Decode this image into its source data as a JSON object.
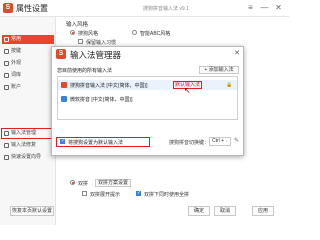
{
  "window": {
    "logo": "S",
    "title": "属性设置",
    "subtitle": "搜狗拼音输入法 v9.1",
    "controls": {
      "menu": "≡",
      "minimize": "—",
      "close": "✕"
    }
  },
  "sidebar": {
    "items": [
      {
        "label": "常用",
        "state": "active"
      },
      {
        "label": "按键",
        "state": ""
      },
      {
        "label": "外观",
        "state": ""
      },
      {
        "label": "词库",
        "state": ""
      },
      {
        "label": "账户",
        "state": ""
      },
      {
        "label": "输入法管理",
        "state": "highlight"
      },
      {
        "label": "输入法修复",
        "state": ""
      },
      {
        "label": "快速设置向导",
        "state": ""
      }
    ],
    "restore_button": "恢复本页默认设置"
  },
  "main": {
    "section_title": "输入风格",
    "style_options": [
      {
        "label": "搜狗风格",
        "checked": true
      },
      {
        "label": "智能ABC风格",
        "checked": false
      }
    ],
    "keep_habit_label": "保留输入习惯",
    "bottom": {
      "double_pinyin_label": "双拼",
      "double_pinyin_button": "双拼方案设置",
      "show_double_hint_label": "双拼展开提示",
      "dual_use_label": "双拼下同时使用全拼",
      "buttons": {
        "ok": "确定",
        "cancel": "取消",
        "apply": "应用"
      }
    }
  },
  "dialog": {
    "logo": "S",
    "title": "输入法管理器",
    "close_label": "✕",
    "subtitle": "您目前使用的所有输入法",
    "add_button": "+ 添加输入法",
    "list": [
      {
        "name": "搜狗拼音输入法 [中文(简体，中国)]",
        "icon_color": "#e8462b",
        "selected": true,
        "badge": "默认输入法",
        "lock_icon": "🔒",
        "pointer_icon": "↖"
      },
      {
        "name": "微软拼音 [中文(简体，中国)]",
        "icon_color": "#3b82d6",
        "selected": false
      }
    ],
    "set_default_label": "将搜狗设置为默认输入法",
    "set_default_checked": true,
    "hotkey_label": "搜狗拼音切换键：",
    "hotkey_value": "Ctrl + .",
    "hotkey_edit_icon": "✎"
  }
}
